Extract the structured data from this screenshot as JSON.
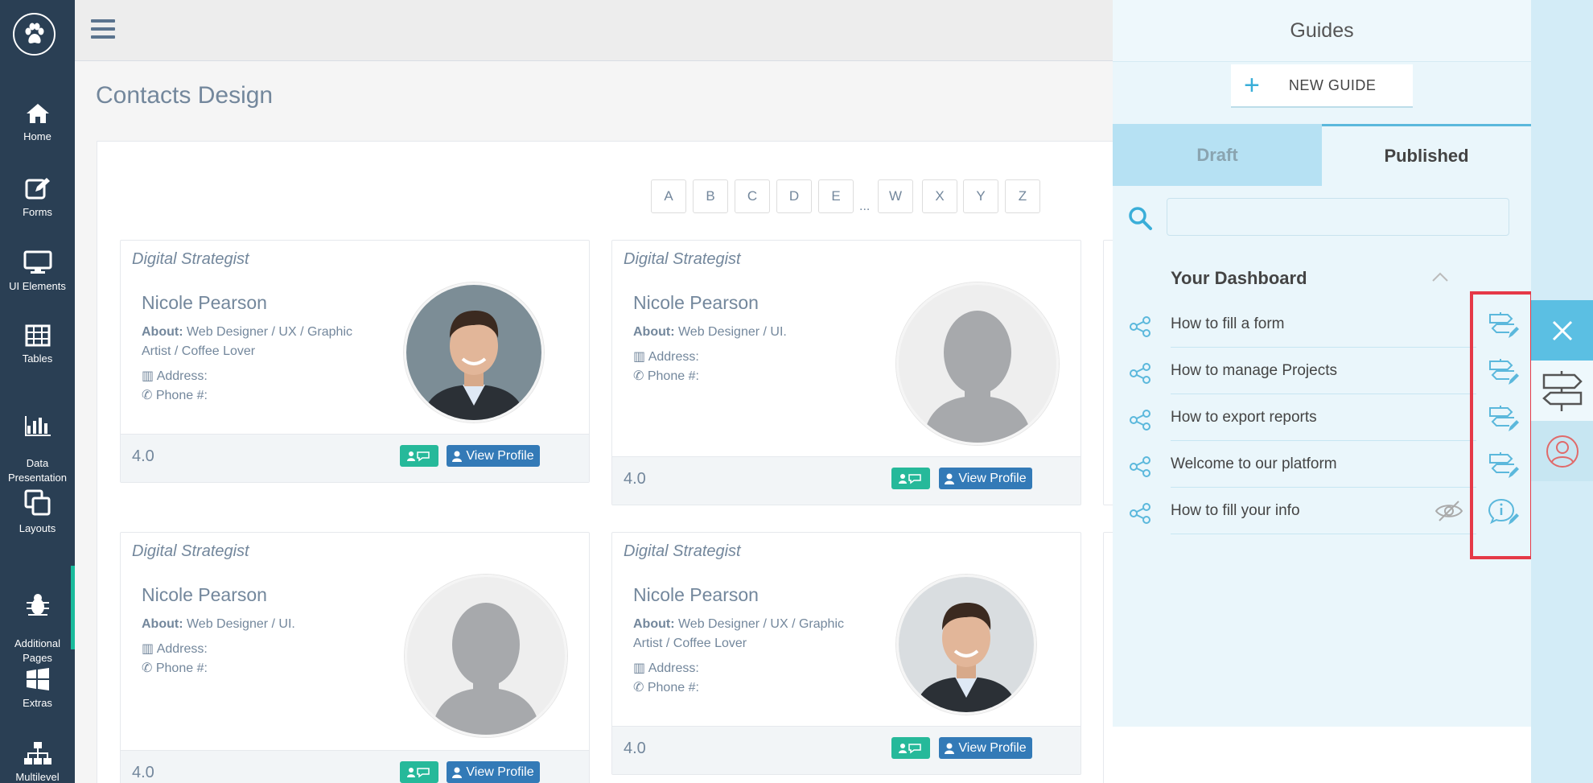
{
  "sidebar": {
    "items": [
      {
        "label": "Home",
        "icon": "home-icon"
      },
      {
        "label": "Forms",
        "icon": "edit-icon"
      },
      {
        "label": "UI Elements",
        "icon": "desktop-icon"
      },
      {
        "label": "Tables",
        "icon": "table-icon"
      },
      {
        "label": "Data\nPresentation",
        "icon": "bar-chart-icon"
      },
      {
        "label": "Layouts",
        "icon": "clone-icon"
      },
      {
        "label": "Additional\nPages",
        "icon": "bug-icon"
      },
      {
        "label": "Extras",
        "icon": "windows-icon"
      },
      {
        "label": "Multilevel",
        "icon": "sitemap-icon"
      }
    ]
  },
  "page": {
    "title": "Contacts Design"
  },
  "alphabet": [
    "A",
    "B",
    "C",
    "D",
    "E",
    "W",
    "X",
    "Y",
    "Z"
  ],
  "alphabet_ellipsis": "...",
  "cards": [
    {
      "role": "Digital Strategist",
      "name": "Nicole Pearson",
      "about_label": "About:",
      "about": "Web Designer / UX / Graphic Artist / Coffee Lover",
      "address": "Address:",
      "phone": "Phone #:",
      "rating": "4.0",
      "view_label": "View Profile",
      "avatar": "photo"
    },
    {
      "role": "Digital Strategist",
      "name": "Nicole Pearson",
      "about_label": "About:",
      "about": "Web Designer / UI.",
      "address": "Address:",
      "phone": "Phone #:",
      "rating": "4.0",
      "view_label": "View Profile",
      "avatar": "placeholder"
    },
    {
      "role": "Digital Strategist",
      "name": "Nicole Pearson",
      "about_label": "About:",
      "about": "Web Designer / UI.",
      "address": "Address:",
      "phone": "Phone #:",
      "rating": "4.0",
      "view_label": "View Profile",
      "avatar": "placeholder"
    },
    {
      "role": "Digital Strategist",
      "name": "Nicole Pearson",
      "about_label": "About:",
      "about": "Web Designer / UX / Graphic Artist / Coffee Lover",
      "address": "Address:",
      "phone": "Phone #:",
      "rating": "4.0",
      "view_label": "View Profile",
      "avatar": "photo"
    }
  ],
  "guides": {
    "title": "Guides",
    "new_guide_label": "NEW GUIDE",
    "tabs": {
      "draft": "Draft",
      "published": "Published"
    },
    "search_placeholder": "",
    "section_title": "Your Dashboard",
    "items": [
      {
        "label": "How to fill a form",
        "hidden": false,
        "type": "tour"
      },
      {
        "label": "How to manage Projects",
        "hidden": false,
        "type": "tour"
      },
      {
        "label": "How to export reports",
        "hidden": false,
        "type": "tour"
      },
      {
        "label": "Welcome to our platform",
        "hidden": false,
        "type": "tour"
      },
      {
        "label": "How to fill your info",
        "hidden": true,
        "type": "info"
      }
    ]
  },
  "colors": {
    "sidebar": "#2a3f54",
    "accent_green": "#26b99a",
    "accent_blue": "#337ab7",
    "guides_blue": "#5bbfe3",
    "highlight_red": "#e53947"
  }
}
